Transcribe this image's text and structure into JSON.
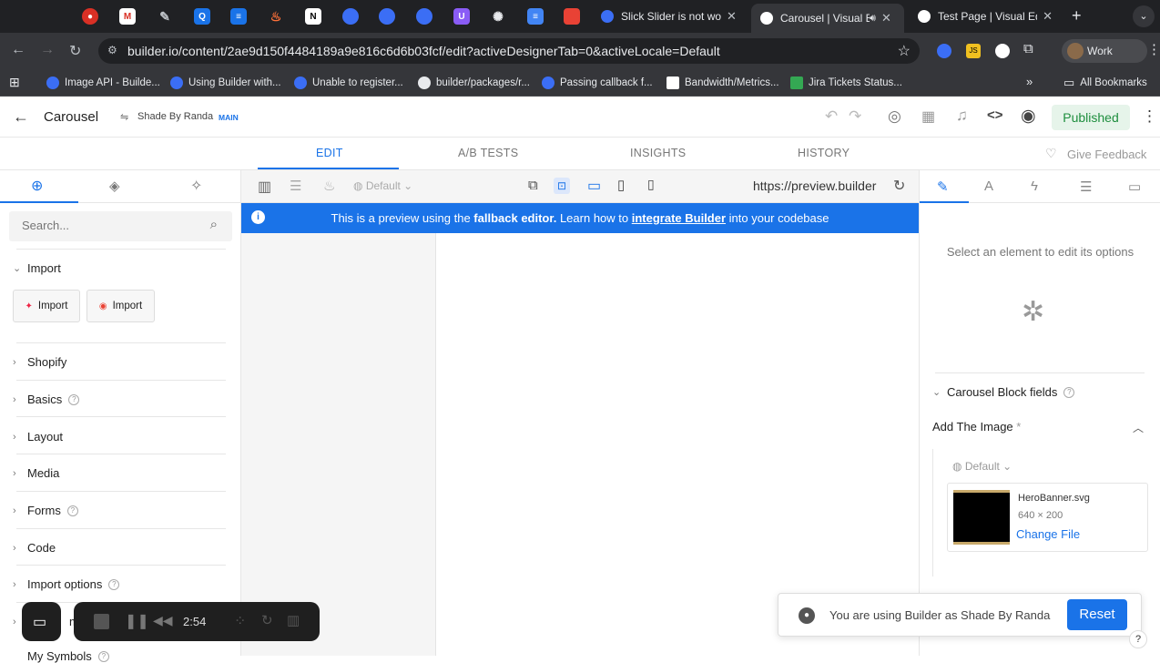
{
  "browser": {
    "tabs": [
      {
        "title": "Slick Slider is not wor",
        "active": false
      },
      {
        "title": "Carousel | Visual E",
        "active": true
      },
      {
        "title": "Test Page | Visual Edi",
        "active": false
      }
    ],
    "url": "builder.io/content/2ae9d150f4484189a9e816c6d6b03fcf/edit?activeDesignerTab=0&activeLocale=Default",
    "profile_label": "Work",
    "bookmarks": [
      "Image API - Builde...",
      "Using Builder with...",
      "Unable to register...",
      "builder/packages/r...",
      "Passing callback f...",
      "Bandwidth/Metrics...",
      "Jira Tickets Status..."
    ],
    "all_bookmarks": "All Bookmarks"
  },
  "header": {
    "title": "Carousel",
    "space_name": "Shade By Randa",
    "branch": "MAIN",
    "published_label": "Published"
  },
  "subnav": {
    "tabs": [
      "EDIT",
      "A/B TESTS",
      "INSIGHTS",
      "HISTORY"
    ],
    "give_feedback": "Give Feedback"
  },
  "left_panel": {
    "search_placeholder": "Search...",
    "import_section": "Import",
    "import_buttons": [
      "Import",
      "Import"
    ],
    "sections": [
      "Shopify",
      "Basics",
      "Layout",
      "Media",
      "Forms",
      "Code",
      "Import options"
    ],
    "partial_section": "mp",
    "partial_bottom": "My Symbols"
  },
  "canvas": {
    "locale": "Default",
    "preview_url": "https://preview.builder",
    "banner": {
      "pre": "This is a preview using the ",
      "bold": "fallback editor.",
      "mid": " Learn how to ",
      "link": "integrate Builder",
      "post": " into your codebase"
    }
  },
  "right_panel": {
    "empty_message": "Select an element to edit its options",
    "block_fields_title": "Carousel Block fields",
    "field_label": "Add The Image",
    "required_mark": "*",
    "locale": "Default",
    "file_name": "HeroBanner.svg",
    "file_dims": "640 × 200",
    "change_file": "Change File"
  },
  "recorder": {
    "time": "2:54"
  },
  "toast": {
    "message": "You are using Builder as Shade By Randa",
    "reset": "Reset"
  },
  "colors": {
    "accent": "#1a73e8",
    "published_bg": "#e6f4ea",
    "published_fg": "#1e8e3e"
  }
}
